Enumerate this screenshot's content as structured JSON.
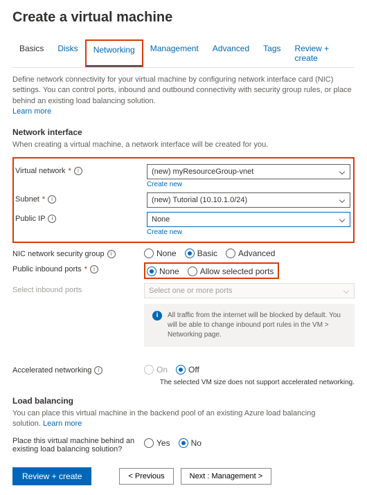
{
  "title": "Create a virtual machine",
  "tabs": [
    "Basics",
    "Disks",
    "Networking",
    "Management",
    "Advanced",
    "Tags",
    "Review + create"
  ],
  "activeTab": "Networking",
  "intro": "Define network connectivity for your virtual machine by configuring network interface card (NIC) settings. You can control ports, inbound and outbound connectivity with security group rules, or place behind an existing load balancing solution.",
  "learnMore": "Learn more",
  "sections": {
    "netif": {
      "heading": "Network interface",
      "sub": "When creating a virtual machine, a network interface will be created for you."
    },
    "lb": {
      "heading": "Load balancing",
      "sub": "You can place this virtual machine in the backend pool of an existing Azure load balancing solution."
    }
  },
  "fields": {
    "vnet": {
      "label": "Virtual network",
      "value": "(new) myResourceGroup-vnet",
      "create": "Create new"
    },
    "subnet": {
      "label": "Subnet",
      "value": "(new) Tutorial (10.10.1.0/24)"
    },
    "pip": {
      "label": "Public IP",
      "value": "None",
      "create": "Create new"
    },
    "nsg": {
      "label": "NIC network security group",
      "options": [
        "None",
        "Basic",
        "Advanced"
      ],
      "selected": "Basic"
    },
    "inbound": {
      "label": "Public inbound ports",
      "options": [
        "None",
        "Allow selected ports"
      ],
      "selected": "None"
    },
    "selectPorts": {
      "label": "Select inbound ports",
      "placeholder": "Select one or more ports"
    },
    "accel": {
      "label": "Accelerated networking",
      "options": [
        "On",
        "Off"
      ],
      "selected": "Off",
      "note": "The selected VM size does not support accelerated networking."
    },
    "lbq": {
      "label": "Place this virtual machine behind an existing load balancing solution?",
      "options": [
        "Yes",
        "No"
      ],
      "selected": "No"
    }
  },
  "infobox": "All traffic from the internet will be blocked by default. You will be able to change inbound port rules in the VM > Networking page.",
  "buttons": {
    "review": "Review + create",
    "prev": "< Previous",
    "next": "Next : Management >"
  }
}
